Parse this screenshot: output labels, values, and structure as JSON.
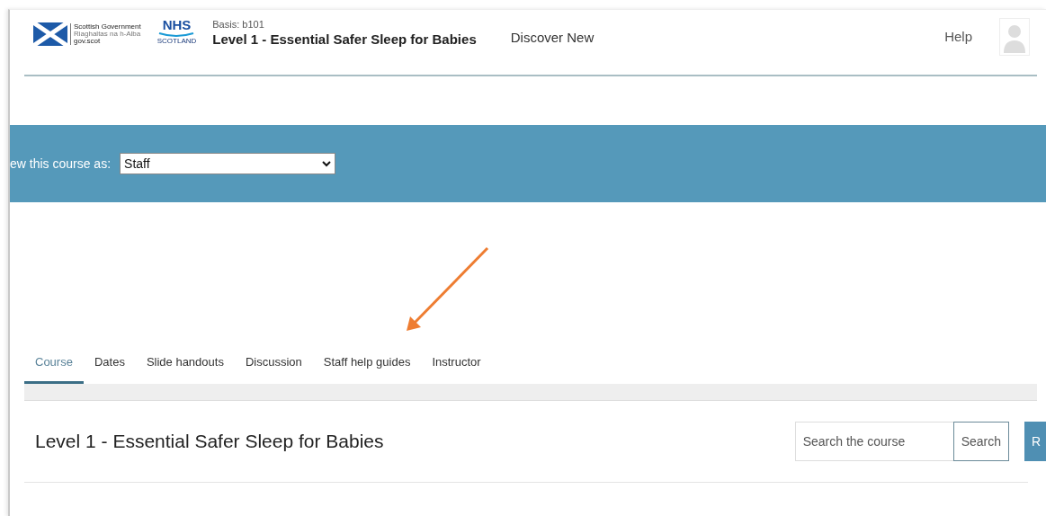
{
  "header": {
    "logo_lines": [
      "Scottish Government",
      "Riaghaltas na h-Alba",
      "gov.scot"
    ],
    "nhs_logo": {
      "name": "NHS",
      "region": "SCOTLAND"
    },
    "course_code": "Basis: b101",
    "course_title": "Level 1 - Essential Safer Sleep for Babies",
    "nav": [
      "Discover New"
    ],
    "help": "Help"
  },
  "view_bar": {
    "label": "ew this course as:",
    "select": {
      "value": "Staff"
    }
  },
  "tabs": [
    {
      "label": "Course",
      "selected": true
    },
    {
      "label": "Dates",
      "selected": false
    },
    {
      "label": "Slide handouts",
      "selected": false
    },
    {
      "label": "Discussion",
      "selected": false
    },
    {
      "label": "Staff help guides",
      "selected": false
    },
    {
      "label": "Instructor",
      "selected": false
    }
  ],
  "course": {
    "title": "Level 1 - Essential Safer Sleep for Babies",
    "search": {
      "placeholder": "Search the course",
      "button": "Search"
    },
    "action_button": "R"
  }
}
